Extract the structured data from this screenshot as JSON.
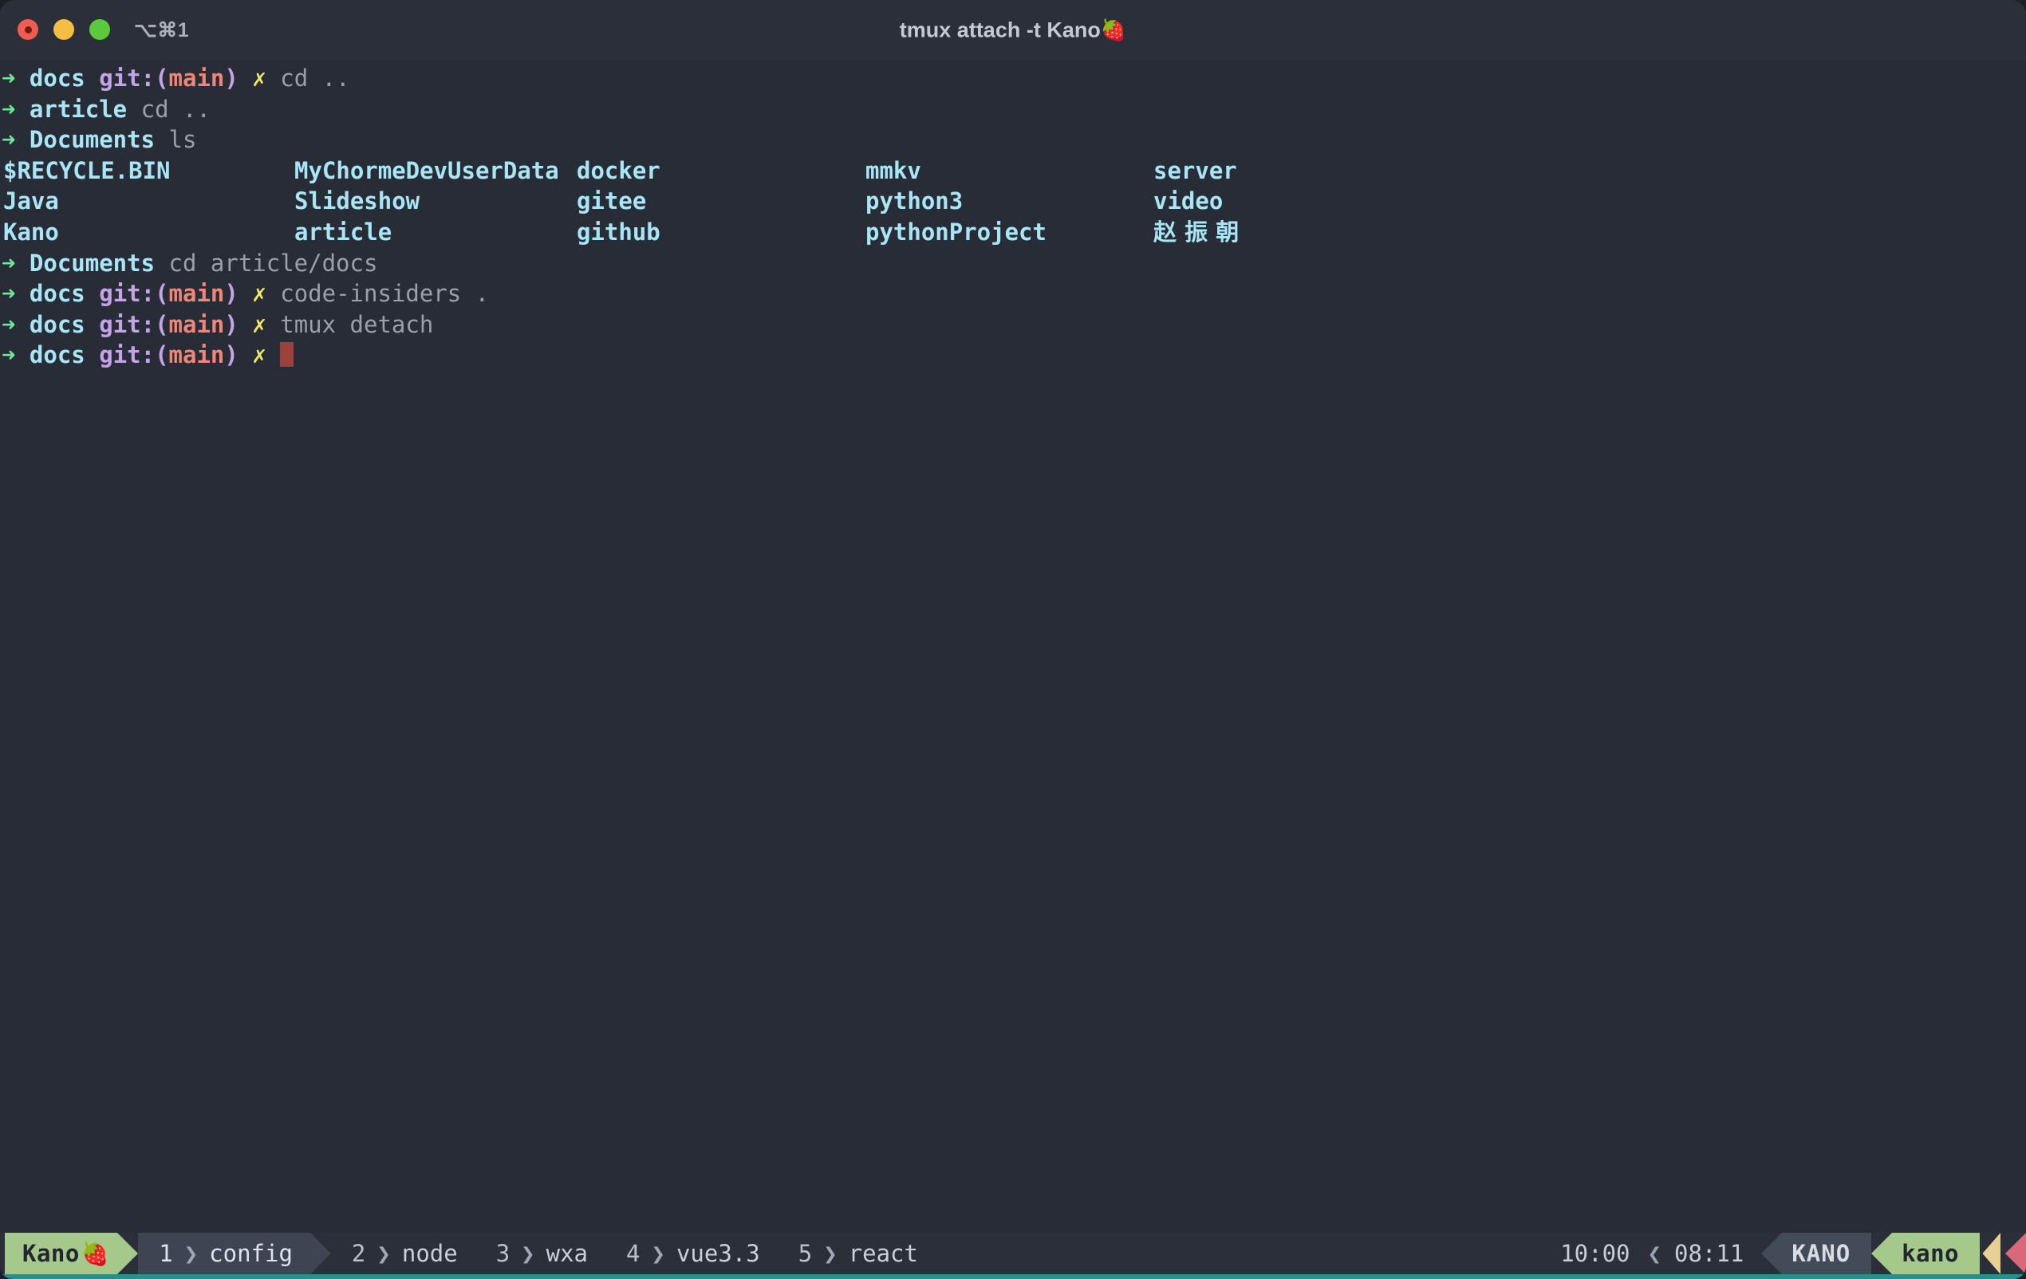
{
  "window": {
    "shortcut_label": "⌥⌘1",
    "title": "tmux attach -t Kano",
    "title_emoji": "🍓",
    "traffic_lights": [
      "close-red",
      "minimize-yellow",
      "maximize-green"
    ],
    "background_color": "#282c36",
    "titlebar_color": "#2b2f3a",
    "accent_color": "#2a8f8a"
  },
  "terminal": {
    "prompt_symbol": "➜",
    "colors": {
      "arrow": "#6ee896",
      "directory": "#a8e5f5",
      "git_label": "#c6a3e8",
      "branch": "#f08678",
      "dirty_mark": "#f2e96b",
      "command": "#9aa0ab",
      "cursor": "#9e413c"
    },
    "lines": [
      {
        "kind": "prompt",
        "cwd": "docs",
        "git": true,
        "git_open": "git:(",
        "branch": "main",
        "git_close": ")",
        "dirty": "✗",
        "command": "cd .."
      },
      {
        "kind": "prompt",
        "cwd": "article",
        "git": false,
        "command": "cd .."
      },
      {
        "kind": "prompt",
        "cwd": "Documents",
        "git": false,
        "command": "ls"
      },
      {
        "kind": "ls",
        "cols": [
          "$RECYCLE.BIN",
          "MyChormeDevUserData",
          "docker",
          "mmkv",
          "server"
        ]
      },
      {
        "kind": "ls",
        "cols": [
          "Java",
          "Slideshow",
          "gitee",
          "python3",
          "video"
        ]
      },
      {
        "kind": "ls",
        "cols": [
          "Kano",
          "article",
          "github",
          "pythonProject",
          "赵振朝"
        ]
      },
      {
        "kind": "prompt",
        "cwd": "Documents",
        "git": false,
        "command": "cd article/docs"
      },
      {
        "kind": "prompt",
        "cwd": "docs",
        "git": true,
        "git_open": "git:(",
        "branch": "main",
        "git_close": ")",
        "dirty": "✗",
        "command": "code-insiders ."
      },
      {
        "kind": "prompt",
        "cwd": "docs",
        "git": true,
        "git_open": "git:(",
        "branch": "main",
        "git_close": ")",
        "dirty": "✗",
        "command": "tmux detach"
      },
      {
        "kind": "prompt",
        "cwd": "docs",
        "git": true,
        "git_open": "git:(",
        "branch": "main",
        "git_close": ")",
        "dirty": "✗",
        "command": "",
        "cursor": true
      }
    ]
  },
  "statusbar": {
    "session": {
      "name": "Kano",
      "emoji": "🍓",
      "color": "#a4c98a"
    },
    "separator_glyph": "❯",
    "windows": [
      {
        "index": "1",
        "name": "config",
        "active": true
      },
      {
        "index": "2",
        "name": "node",
        "active": false
      },
      {
        "index": "3",
        "name": "wxa",
        "active": false
      },
      {
        "index": "4",
        "name": "vue3.3",
        "active": false
      },
      {
        "index": "5",
        "name": "react",
        "active": false
      }
    ],
    "right": {
      "time_primary": "10:00",
      "divider_glyph": "❮",
      "time_secondary": "08:11",
      "host": "KANO",
      "user": "kano",
      "host_color": "#434a58",
      "user_color": "#a4c98a",
      "tail_tan_color": "#e8cf94",
      "tail_red_color": "#d9697a"
    }
  }
}
